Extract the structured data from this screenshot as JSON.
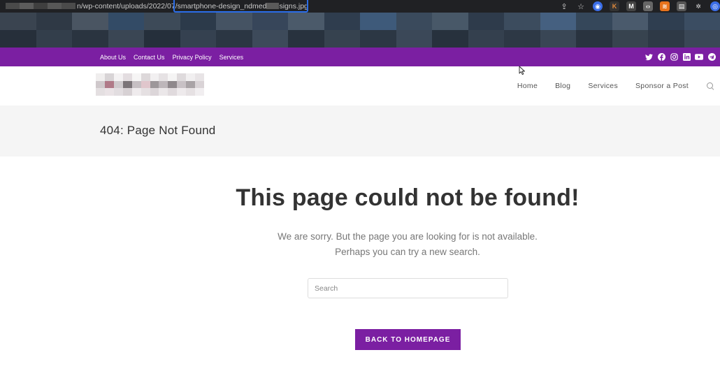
{
  "browser": {
    "url_prefix": "n/wp-content/uploads/2022/07/",
    "url_file_start": "smartphone-design_ndmed",
    "url_file_end": "signs.jpg",
    "highlight_color": "#2b6de8",
    "icons": [
      "share-icon",
      "star-icon",
      "extension-icons"
    ]
  },
  "topbar": {
    "bg_color": "#7b1fa2",
    "links": [
      "About Us",
      "Contact Us",
      "Privacy Policy",
      "Services"
    ],
    "social_icons": [
      "twitter-icon",
      "facebook-icon",
      "instagram-icon",
      "linkedin-icon",
      "youtube-icon",
      "telegram-icon"
    ]
  },
  "header": {
    "nav": [
      "Home",
      "Blog",
      "Services",
      "Sponsor a Post"
    ]
  },
  "page": {
    "title": "404: Page Not Found",
    "headline": "This page could not be found!",
    "line1": "We are sorry. But the page you are looking for is not available.",
    "line2": "Perhaps you can try a new search.",
    "search_placeholder": "Search",
    "button_label": "BACK TO HOMEPAGE",
    "accent_color": "#7b1fa2"
  }
}
